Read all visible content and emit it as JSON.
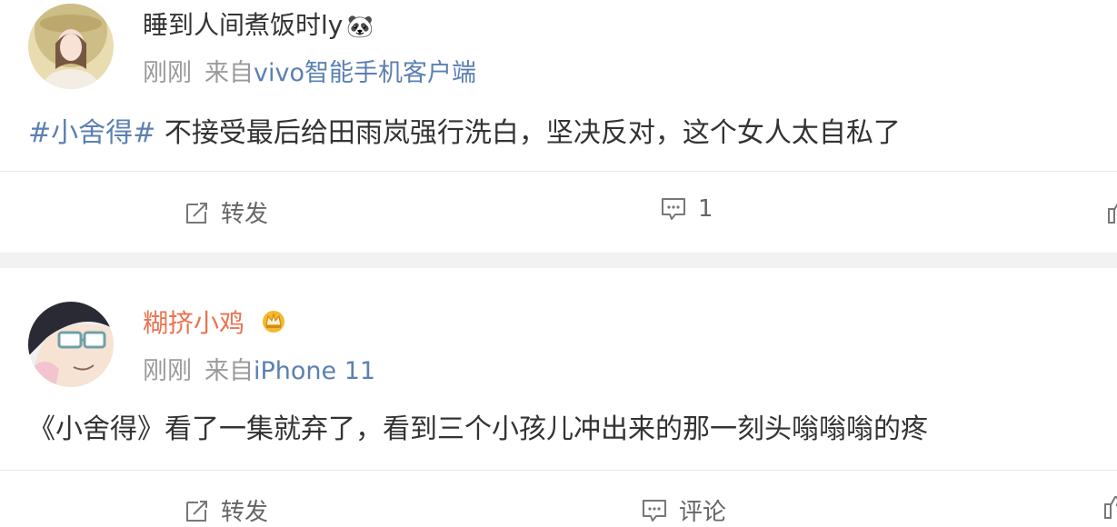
{
  "posts": [
    {
      "username": "睡到人间煮饭时ly",
      "username_emoji": "🐼",
      "time": "刚刚",
      "source_prefix": "来自",
      "source": "vivo智能手机客户端",
      "hashtag": "#小舍得#",
      "text": " 不接受最后给田雨岚强行洗白，坚决反对，这个女人太自私了",
      "actions": {
        "repost": "转发",
        "comment": "1"
      }
    },
    {
      "username": "糊挤小鸡",
      "username_color": "#eb7350",
      "time": "刚刚",
      "source_prefix": "来自",
      "source": "iPhone 11",
      "text": "《小舍得》看了一集就弃了，看到三个小孩儿冲出来的那一刻头嗡嗡嗡的疼",
      "actions": {
        "repost": "转发",
        "comment": "评论"
      }
    }
  ],
  "colors": {
    "link": "#5b80b2",
    "meta": "#9a9a9a",
    "orange_name": "#eb7350",
    "vip_badge": "#f5b82e"
  }
}
